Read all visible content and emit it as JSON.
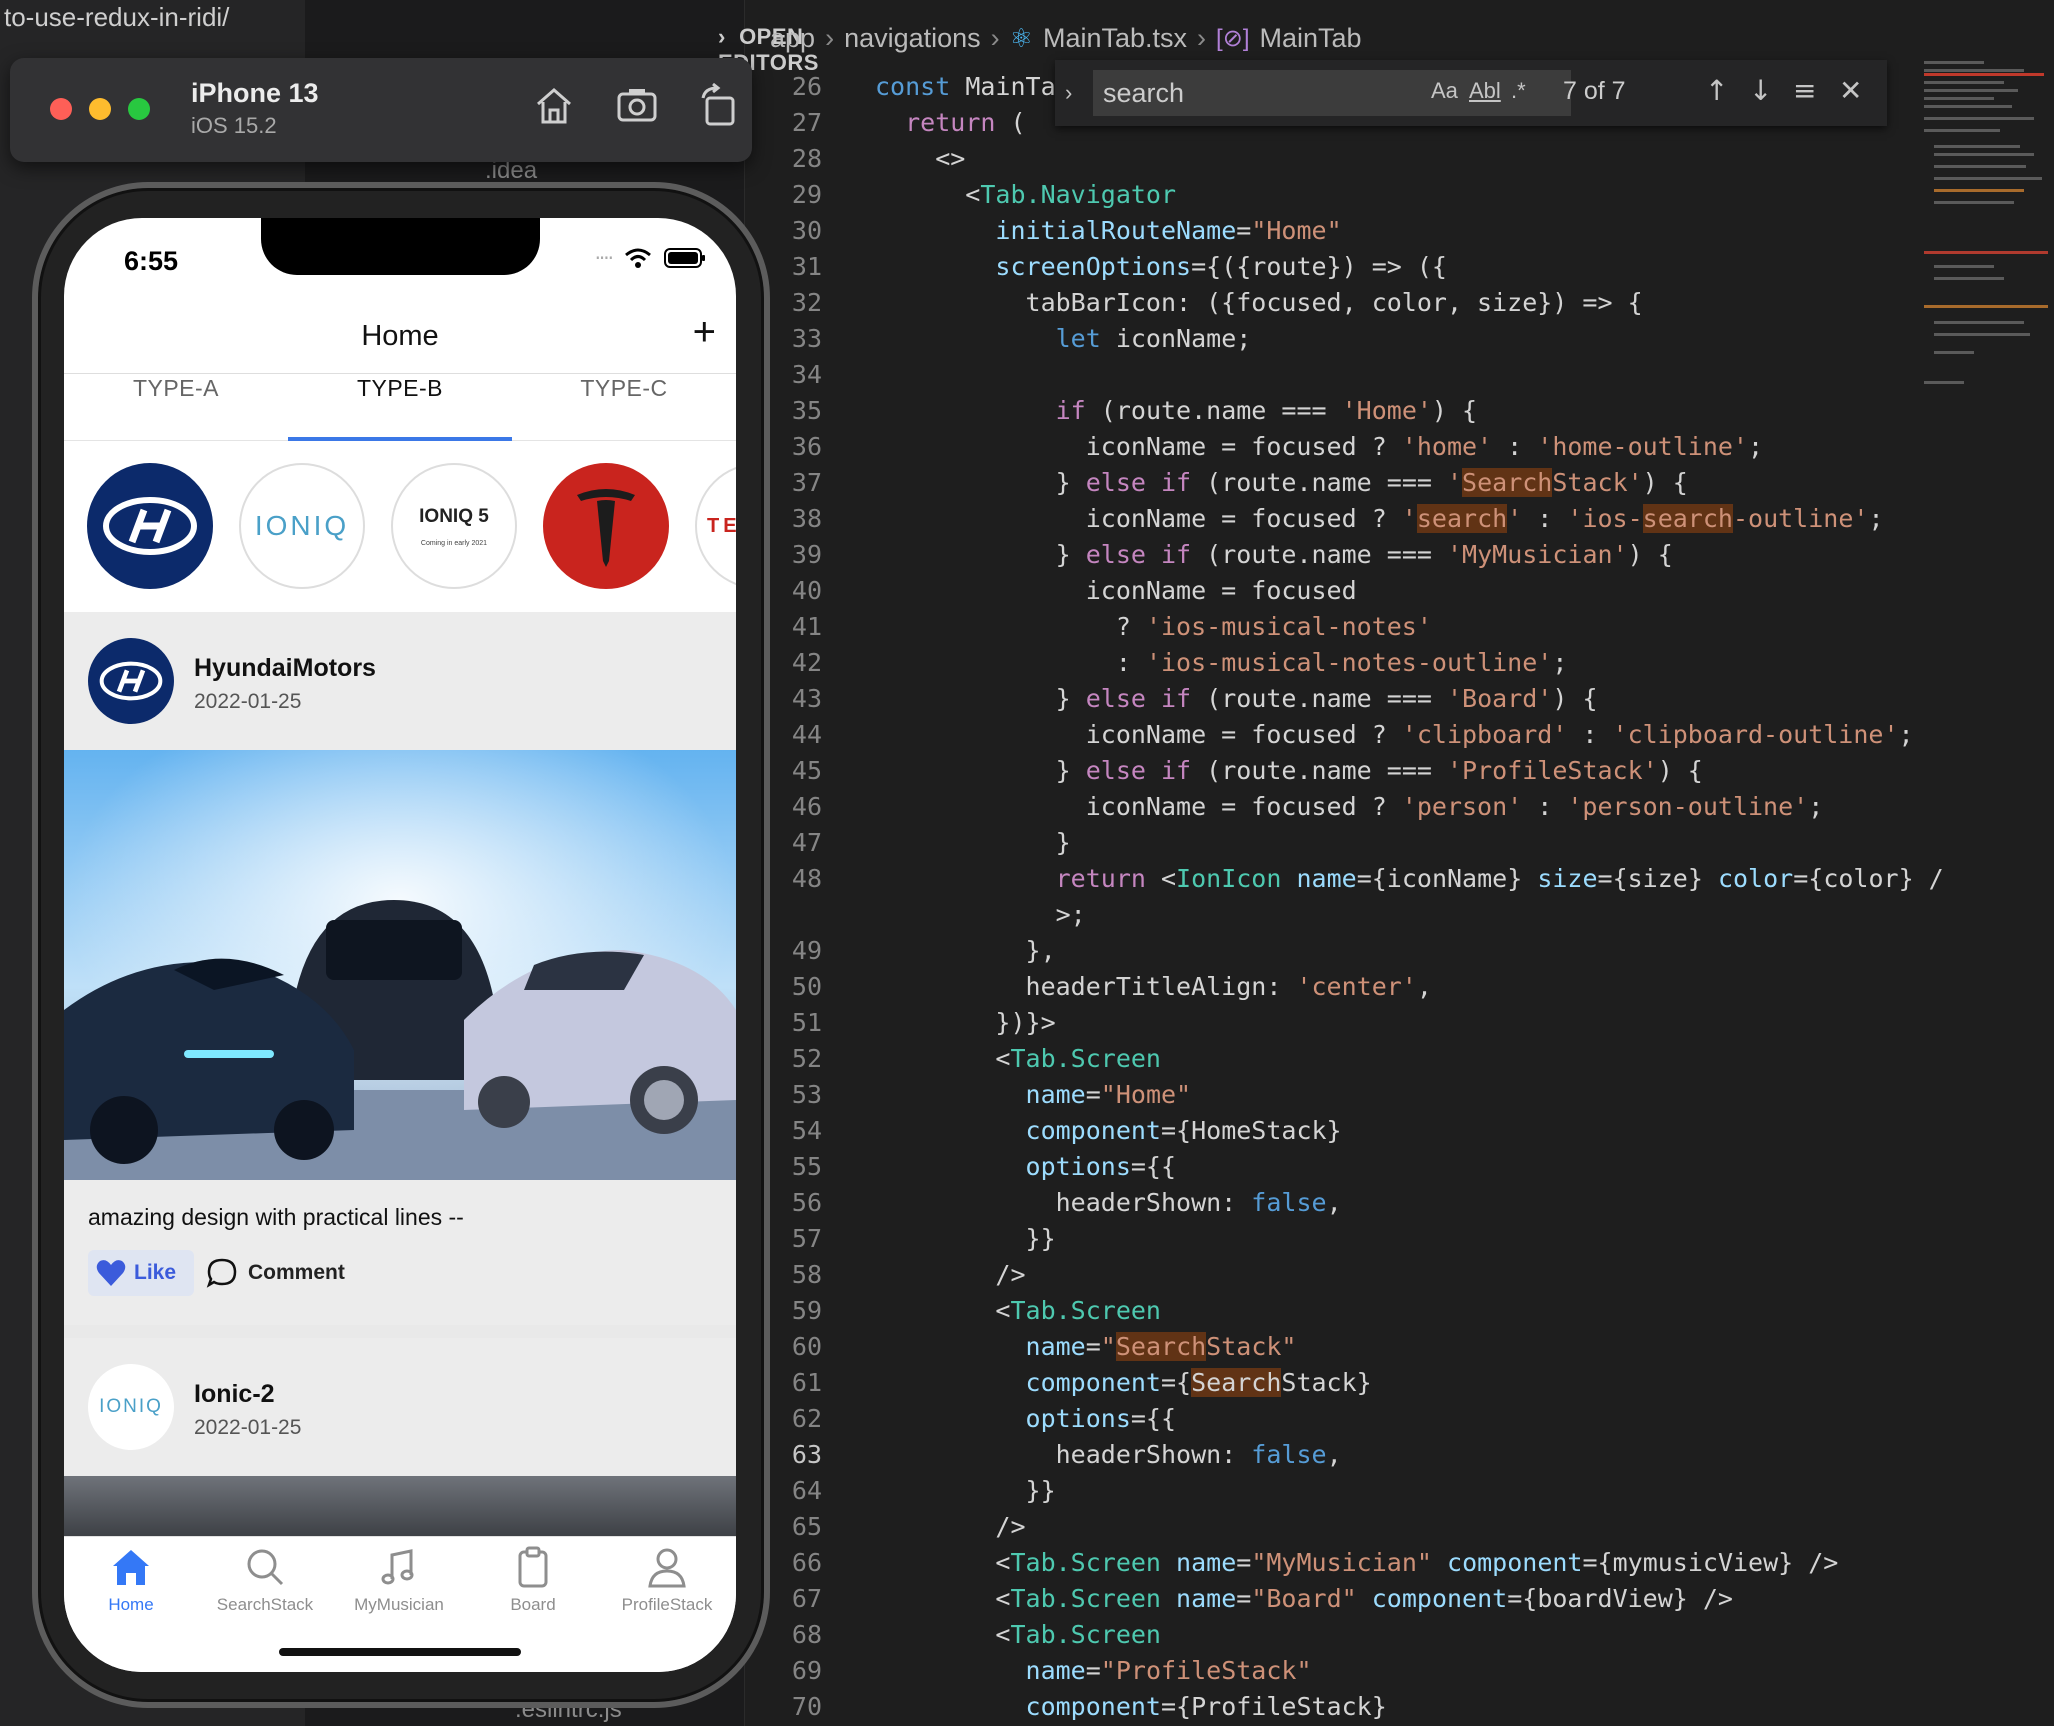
{
  "editor": {
    "partial_title": "to-use-redux-in-ridi/",
    "explorer": {
      "open_editors_label": "OPEN EDITORS",
      "tree_items": [
        ".idea",
        ".eslintrc.js"
      ]
    },
    "breadcrumb": [
      "app",
      "navigations",
      "MainTab.tsx",
      "MainTab"
    ],
    "find": {
      "query": "search",
      "case_label": "Aa",
      "word_label": "Abl",
      "regex_label": ".*",
      "count": "7 of 7"
    },
    "code_lines": [
      {
        "n": "26",
        "t": "const MainTa"
      },
      {
        "n": "27",
        "t": "  return ("
      },
      {
        "n": "28",
        "t": "    <>"
      },
      {
        "n": "29",
        "t": "      <Tab.Navigator"
      },
      {
        "n": "30",
        "t": "        initialRouteName=\"Home\""
      },
      {
        "n": "31",
        "t": "        screenOptions={({route}) => ({"
      },
      {
        "n": "32",
        "t": "          tabBarIcon: ({focused, color, size}) => {"
      },
      {
        "n": "33",
        "t": "            let iconName;"
      },
      {
        "n": "34",
        "t": ""
      },
      {
        "n": "35",
        "t": "            if (route.name === 'Home') {"
      },
      {
        "n": "36",
        "t": "              iconName = focused ? 'home' : 'home-outline';"
      },
      {
        "n": "37",
        "t": "            } else if (route.name === 'SearchStack') {"
      },
      {
        "n": "38",
        "t": "              iconName = focused ? 'search' : 'ios-search-outline';"
      },
      {
        "n": "39",
        "t": "            } else if (route.name === 'MyMusician') {"
      },
      {
        "n": "40",
        "t": "              iconName = focused"
      },
      {
        "n": "41",
        "t": "                ? 'ios-musical-notes'"
      },
      {
        "n": "42",
        "t": "                : 'ios-musical-notes-outline';"
      },
      {
        "n": "43",
        "t": "            } else if (route.name === 'Board') {"
      },
      {
        "n": "44",
        "t": "              iconName = focused ? 'clipboard' : 'clipboard-outline';"
      },
      {
        "n": "45",
        "t": "            } else if (route.name === 'ProfileStack') {"
      },
      {
        "n": "46",
        "t": "              iconName = focused ? 'person' : 'person-outline';"
      },
      {
        "n": "47",
        "t": "            }"
      },
      {
        "n": "48",
        "t": "            return <IonIcon name={iconName} size={size} color={color} /"
      },
      {
        "n": "",
        "t": "            >;"
      },
      {
        "n": "49",
        "t": "          },"
      },
      {
        "n": "50",
        "t": "          headerTitleAlign: 'center',"
      },
      {
        "n": "51",
        "t": "        })}>"
      },
      {
        "n": "52",
        "t": "        <Tab.Screen"
      },
      {
        "n": "53",
        "t": "          name=\"Home\""
      },
      {
        "n": "54",
        "t": "          component={HomeStack}"
      },
      {
        "n": "55",
        "t": "          options={{"
      },
      {
        "n": "56",
        "t": "            headerShown: false,"
      },
      {
        "n": "57",
        "t": "          }}"
      },
      {
        "n": "58",
        "t": "        />"
      },
      {
        "n": "59",
        "t": "        <Tab.Screen"
      },
      {
        "n": "60",
        "t": "          name=\"SearchStack\""
      },
      {
        "n": "61",
        "t": "          component={SearchStack}"
      },
      {
        "n": "62",
        "t": "          options={{"
      },
      {
        "n": "63",
        "t": "            headerShown: false,"
      },
      {
        "n": "64",
        "t": "          }}"
      },
      {
        "n": "65",
        "t": "        />"
      },
      {
        "n": "66",
        "t": "        <Tab.Screen name=\"MyMusician\" component={mymusicView} />"
      },
      {
        "n": "67",
        "t": "        <Tab.Screen name=\"Board\" component={boardView} />"
      },
      {
        "n": "68",
        "t": "        <Tab.Screen"
      },
      {
        "n": "69",
        "t": "          name=\"ProfileStack\""
      },
      {
        "n": "70",
        "t": "          component={ProfileStack}"
      }
    ],
    "colors": {
      "background": "#1e1e1e",
      "keyword": "#569cd6",
      "string": "#ce9178",
      "type": "#4ec9b0",
      "match_highlight": "#613315"
    }
  },
  "simulator": {
    "device": "iPhone 13",
    "os": "iOS 15.2",
    "toolbar_icons": [
      "home-icon",
      "screenshot-icon",
      "rotate-icon"
    ]
  },
  "app": {
    "status_time": "6:55",
    "header_title": "Home",
    "add_symbol": "+",
    "top_tabs": [
      "TYPE-A",
      "TYPE-B",
      "TYPE-C"
    ],
    "active_top_tab": "TYPE-B",
    "stories": [
      {
        "name": "hyundai",
        "label": ""
      },
      {
        "name": "ioniq",
        "label": "IONIQ"
      },
      {
        "name": "ioniq5",
        "label": "IONIQ 5",
        "sub": "Coming in early 2021"
      },
      {
        "name": "tesla",
        "label": ""
      },
      {
        "name": "tesla-wordmark",
        "label": "TE"
      }
    ],
    "posts": [
      {
        "author": "HyundaiMotors",
        "date": "2022-01-25",
        "caption": "amazing design with practical lines --",
        "like_label": "Like",
        "comment_label": "Comment"
      },
      {
        "author": "Ionic-2",
        "date": "2022-01-25",
        "avatar_text": "IONIQ"
      }
    ],
    "bottom_tabs": [
      "Home",
      "SearchStack",
      "MyMusician",
      "Board",
      "ProfileStack"
    ],
    "active_bottom_tab": "Home",
    "accent_color": "#3478f6"
  }
}
